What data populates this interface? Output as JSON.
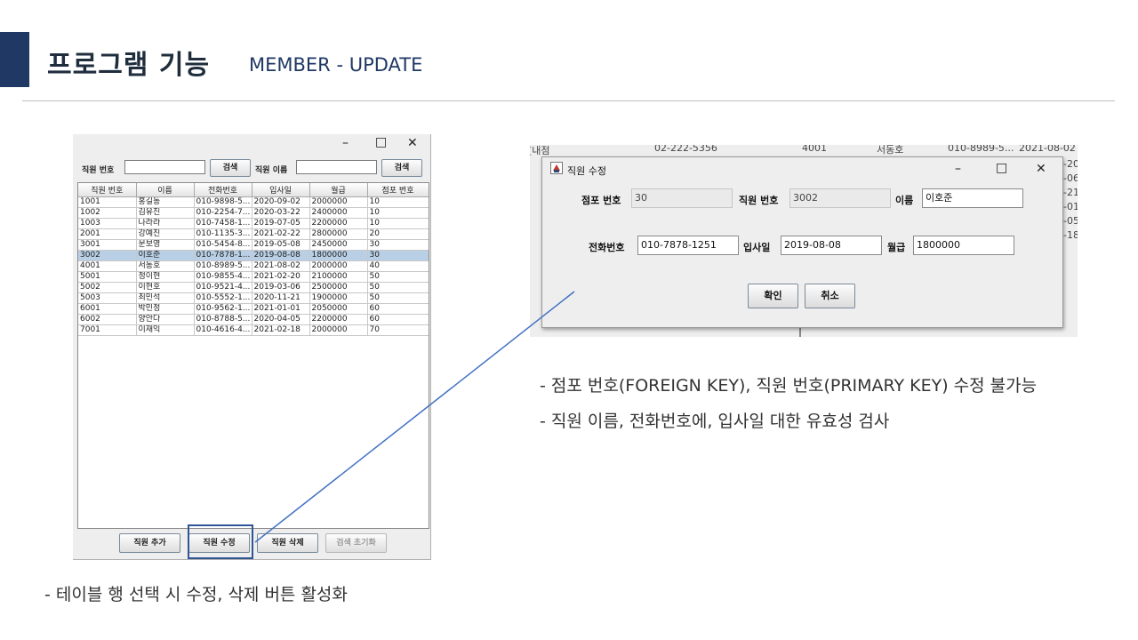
{
  "slide": {
    "title": "프로그램 기능",
    "subtitle": "MEMBER - UPDATE"
  },
  "main_window": {
    "controls": {
      "minimize": "–",
      "maximize": "□",
      "close": "✕"
    },
    "search": {
      "id_label": "직원 번호",
      "id_value": "",
      "id_button": "검색",
      "name_label": "직원 이름",
      "name_value": "",
      "name_button": "검색"
    },
    "table": {
      "columns": [
        "직원 번호",
        "이름",
        "전화번호",
        "입사일",
        "월급",
        "점포 번호"
      ],
      "rows": [
        [
          "1001",
          "홍길동",
          "010-9898-5...",
          "2020-09-02",
          "2000000",
          "10"
        ],
        [
          "1002",
          "김유진",
          "010-2254-7...",
          "2020-03-22",
          "2400000",
          "10"
        ],
        [
          "1003",
          "나라라",
          "010-7458-1...",
          "2019-07-05",
          "2200000",
          "10"
        ],
        [
          "2001",
          "강예진",
          "010-1135-3...",
          "2021-02-22",
          "2800000",
          "20"
        ],
        [
          "3001",
          "문보영",
          "010-5454-8...",
          "2019-05-08",
          "2450000",
          "30"
        ],
        [
          "3002",
          "이호준",
          "010-7878-1...",
          "2019-08-08",
          "1800000",
          "30"
        ],
        [
          "4001",
          "서동호",
          "010-8989-5...",
          "2021-08-02",
          "2000000",
          "40"
        ],
        [
          "5001",
          "정이현",
          "010-9855-4...",
          "2021-02-20",
          "2100000",
          "50"
        ],
        [
          "5002",
          "이현호",
          "010-9521-4...",
          "2019-03-06",
          "2500000",
          "50"
        ],
        [
          "5003",
          "최민석",
          "010-5552-1...",
          "2020-11-21",
          "1900000",
          "50"
        ],
        [
          "6001",
          "박민정",
          "010-9562-1...",
          "2021-01-01",
          "2050000",
          "60"
        ],
        [
          "6002",
          "양안다",
          "010-8788-5...",
          "2020-04-05",
          "2200000",
          "60"
        ],
        [
          "7001",
          "이재익",
          "010-4616-4...",
          "2021-02-18",
          "2000000",
          "70"
        ]
      ],
      "selected_index": 5
    },
    "buttons": {
      "add": "직원 추가",
      "edit": "직원 수정",
      "delete": "직원 삭제",
      "reset": "검색 초기화"
    }
  },
  "background_window": {
    "fragments": [
      "[내점",
      "02-222-5356",
      "4001",
      "서동호",
      "010-8989-5...",
      "2021-08-02"
    ],
    "right_column": [
      "-20",
      "-06",
      "-21",
      "-01",
      "-05",
      "-18"
    ]
  },
  "dialog": {
    "title": "직원 수정",
    "store_label": "점포 번호",
    "store_value": "30",
    "id_label": "직원 번호",
    "id_value": "3002",
    "name_label": "이름",
    "name_value": "이호준",
    "phone_label": "전화번호",
    "phone_value": "010-7878-1251",
    "hire_label": "입사일",
    "hire_value": "2019-08-08",
    "salary_label": "월급",
    "salary_value": "1800000",
    "ok": "확인",
    "cancel": "취소",
    "controls": {
      "minimize": "–",
      "maximize": "□",
      "close": "✕"
    }
  },
  "notes": {
    "right_1": "- 점포 번호(FOREIGN KEY), 직원 번호(PRIMARY KEY) 수정 불가능",
    "right_2": "- 직원 이름, 전화번호에, 입사일 대한 유효성 검사",
    "left": "- 테이블 행  선택 시 수정, 삭제 버튼  활성화"
  },
  "colors": {
    "accent": "#1f3864",
    "highlight": "#2f5597",
    "selected_row": "#b8cfe5"
  }
}
